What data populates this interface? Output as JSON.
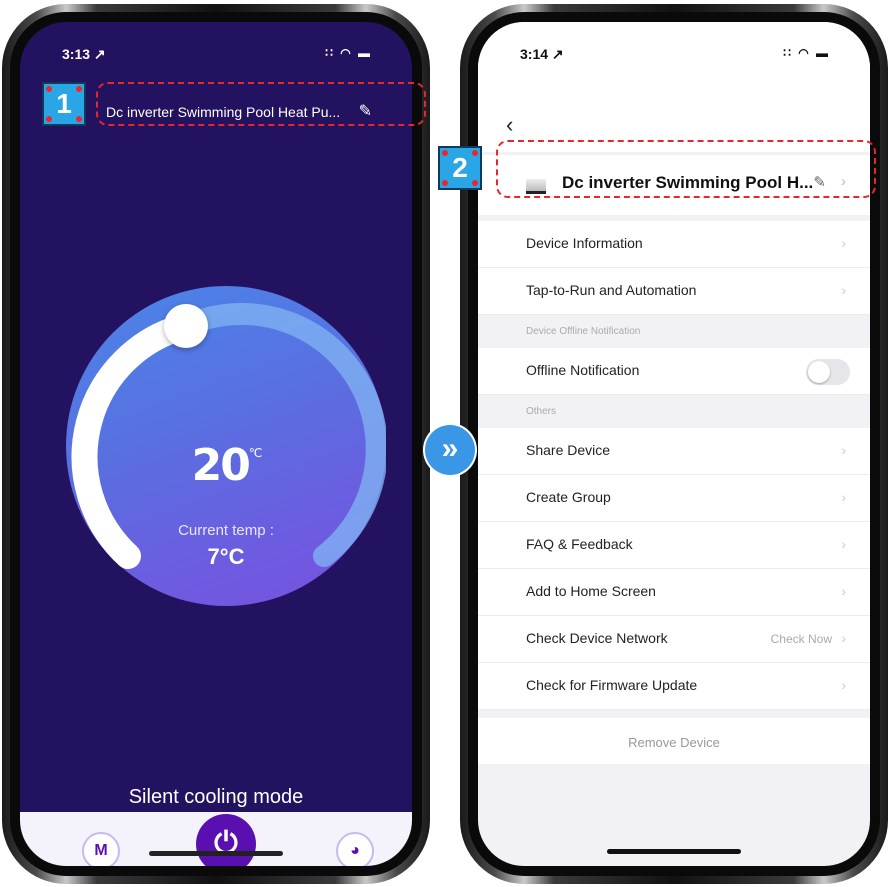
{
  "left": {
    "status_time": "3:13 ↗",
    "status_icons": "∷ ◠ ▬",
    "title": "Dc inverter Swimming Pool Heat Pu...",
    "edit_icon": "✎",
    "set_temp": "20",
    "set_unit": "℃",
    "current_label": "Current temp :",
    "current_temp": "7°C",
    "mode_text": "Silent cooling mode",
    "mode_button": "M",
    "power_icon": "⏻",
    "timer_icon": "◕",
    "colors": {
      "bg": "#22125f",
      "accent": "#5a0fb0"
    }
  },
  "right": {
    "status_time": "3:14 ↗",
    "status_icons": "∷ ◠ ▬",
    "back_icon": "‹",
    "device_name": "Dc inverter Swimming Pool H...",
    "edit_icon": "✎",
    "chevron": "›",
    "rows": [
      {
        "label": "Device Information"
      },
      {
        "label": "Tap-to-Run and Automation"
      }
    ],
    "section_offline": "Device Offline Notification",
    "offline_label": "Offline Notification",
    "offline_enabled": false,
    "section_others": "Others",
    "other_rows": [
      {
        "label": "Share Device"
      },
      {
        "label": "Create Group"
      },
      {
        "label": "FAQ & Feedback"
      },
      {
        "label": "Add to Home Screen"
      },
      {
        "label": "Check Device Network",
        "value": "Check Now"
      },
      {
        "label": "Check for Firmware Update"
      }
    ],
    "remove_label": "Remove Device"
  },
  "annotations": {
    "badge1": "1",
    "badge2": "2",
    "arrow": "»",
    "highlight_color": "#e8262b",
    "badge_color": "#2aa6e6"
  }
}
